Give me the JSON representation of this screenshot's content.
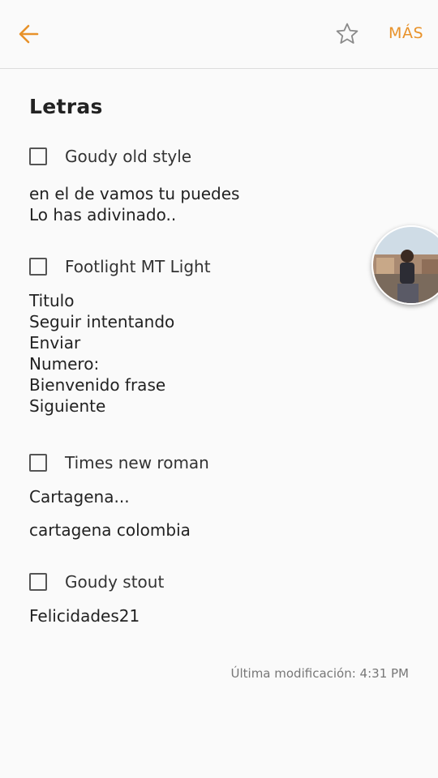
{
  "colors": {
    "accent": "#e8922a",
    "background": "#fafafa",
    "divider": "#dcdcdc"
  },
  "header": {
    "back_icon": "arrow-left-icon",
    "star_icon": "star-outline-icon",
    "more_label": "MÁS"
  },
  "note": {
    "title": "Letras",
    "sections": [
      {
        "checkbox_label": "Goudy old style",
        "checked": false,
        "lines": [
          "en el de vamos tu puedes",
          "Lo has adivinado.."
        ]
      },
      {
        "checkbox_label": "Footlight MT Light",
        "checked": false,
        "lines": [
          "Titulo",
          "Seguir intentando",
          "Enviar",
          "Numero:",
          "Bienvenido frase",
          "Siguiente"
        ]
      },
      {
        "checkbox_label": "Times new roman",
        "checked": false,
        "lines": [
          "Cartagena...",
          "cartagena colombia"
        ]
      },
      {
        "checkbox_label": "Goudy stout",
        "checked": false,
        "lines": [
          "Felicidades21"
        ]
      }
    ]
  },
  "footer": {
    "last_modified": "Última modificación: 4:31 PM"
  },
  "floating_avatar": {
    "icon": "chat-head-avatar"
  }
}
